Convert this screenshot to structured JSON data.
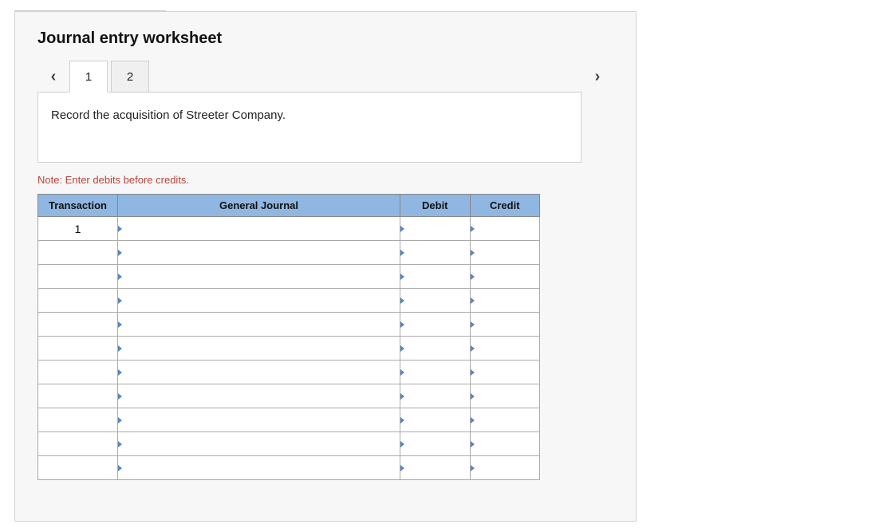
{
  "title": "Journal entry worksheet",
  "nav": {
    "prev_icon": "‹",
    "next_icon": "›"
  },
  "tabs": [
    {
      "label": "1",
      "active": true
    },
    {
      "label": "2",
      "active": false
    }
  ],
  "description": "Record the acquisition of Streeter Company.",
  "note": "Note: Enter debits before credits.",
  "columns": {
    "transaction": "Transaction",
    "general_journal": "General Journal",
    "debit": "Debit",
    "credit": "Credit"
  },
  "rows": [
    {
      "transaction": "1",
      "general_journal": "",
      "debit": "",
      "credit": ""
    },
    {
      "transaction": "",
      "general_journal": "",
      "debit": "",
      "credit": ""
    },
    {
      "transaction": "",
      "general_journal": "",
      "debit": "",
      "credit": ""
    },
    {
      "transaction": "",
      "general_journal": "",
      "debit": "",
      "credit": ""
    },
    {
      "transaction": "",
      "general_journal": "",
      "debit": "",
      "credit": ""
    },
    {
      "transaction": "",
      "general_journal": "",
      "debit": "",
      "credit": ""
    },
    {
      "transaction": "",
      "general_journal": "",
      "debit": "",
      "credit": ""
    },
    {
      "transaction": "",
      "general_journal": "",
      "debit": "",
      "credit": ""
    },
    {
      "transaction": "",
      "general_journal": "",
      "debit": "",
      "credit": ""
    },
    {
      "transaction": "",
      "general_journal": "",
      "debit": "",
      "credit": ""
    },
    {
      "transaction": "",
      "general_journal": "",
      "debit": "",
      "credit": ""
    }
  ]
}
